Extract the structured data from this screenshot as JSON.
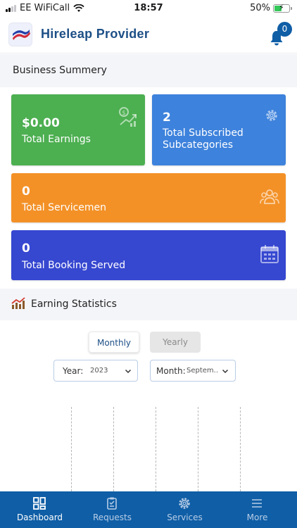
{
  "status": {
    "carrier": "EE WiFiCall",
    "time": "18:57",
    "battery": "50%"
  },
  "header": {
    "title": "Hireleap Provider",
    "notification_count": "0"
  },
  "business": {
    "title": "Business Summery",
    "earnings_value": "$0.00",
    "earnings_label": "Total Earnings",
    "subcat_value": "2",
    "subcat_label": "Total Subscribed Subcategories",
    "servicemen_value": "0",
    "servicemen_label": "Total Servicemen",
    "booking_value": "0",
    "booking_label": "Total Booking Served"
  },
  "stats": {
    "title": "Earning Statistics",
    "monthly_label": "Monthly",
    "yearly_label": "Yearly",
    "year_label": "Year:",
    "year_value": "2023",
    "month_label": "Month:",
    "month_value": "Septem..."
  },
  "nav": {
    "dashboard": "Dashboard",
    "requests": "Requests",
    "services": "Services",
    "more": "More"
  },
  "colors": {
    "brand": "#0f5ea6",
    "earnings_card": "#4caf50",
    "subcategories_card": "#3d82dc",
    "servicemen_card": "#f39127",
    "booking_card": "#3647d0"
  }
}
